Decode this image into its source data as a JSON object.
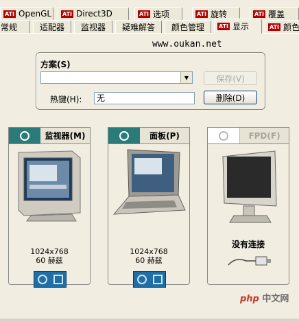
{
  "tabs_top": [
    {
      "label": "OpenGL"
    },
    {
      "label": "Direct3D"
    },
    {
      "label": "选项"
    },
    {
      "label": "旋转"
    },
    {
      "label": "覆盖"
    }
  ],
  "tabs_bottom": [
    {
      "label": "常规"
    },
    {
      "label": "适配器"
    },
    {
      "label": "监视器"
    },
    {
      "label": "疑难解答"
    },
    {
      "label": "颜色管理"
    },
    {
      "label": "显示"
    },
    {
      "label": "颜色"
    }
  ],
  "ati_badge": "ATI",
  "watermark_url": "www.oukan.net",
  "scheme": {
    "group_label": "方案(S)",
    "combo_value": "",
    "save_label": "保存(V)",
    "hotkey_label": "热键(H):",
    "hotkey_value": "无",
    "delete_label": "删除(D)"
  },
  "devices": [
    {
      "title": "监视器(M)",
      "resolution": "1024x768",
      "refresh": "60 赫兹",
      "enabled": true
    },
    {
      "title": "面板(P)",
      "resolution": "1024x768",
      "refresh": "60 赫兹",
      "enabled": true
    },
    {
      "title": "FPD(F)",
      "status": "没有连接",
      "enabled": false
    }
  ],
  "watermark": {
    "brand": "php",
    "text": "中文网"
  },
  "colors": {
    "ati_red": "#b40000",
    "power_teal": "#2c7b7b",
    "mode_blue": "#1f6fa6"
  }
}
